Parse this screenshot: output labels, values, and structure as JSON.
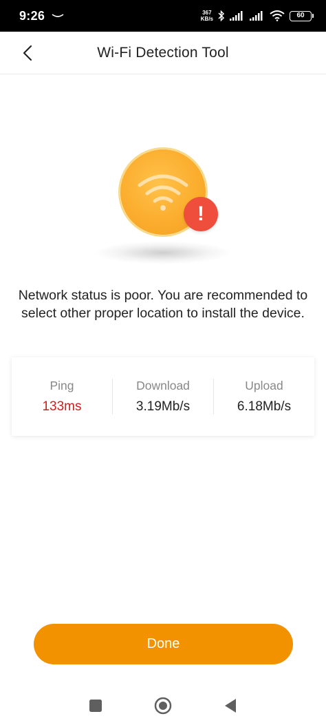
{
  "status_bar": {
    "time": "9:26",
    "net_speed_value": "367",
    "net_speed_unit": "KB/s",
    "battery": "60",
    "icons": [
      "notification-swipe-icon",
      "bluetooth-icon",
      "signal-icon",
      "signal-icon",
      "wifi-icon",
      "battery-icon"
    ]
  },
  "header": {
    "title": "Wi-Fi Detection Tool",
    "back_icon": "chevron-left-icon"
  },
  "illustration": {
    "main_icon": "wifi-icon",
    "badge_icon": "exclamation-icon",
    "badge_text": "!",
    "circle_color": "#fbad2e",
    "badge_color": "#ee4e3b"
  },
  "message": "Network status is poor. You are recommended to select other proper location to install the device.",
  "stats": [
    {
      "label": "Ping",
      "value": "133ms"
    },
    {
      "label": "Download",
      "value": "3.19Mb/s"
    },
    {
      "label": "Upload",
      "value": "6.18Mb/s"
    }
  ],
  "done_label": "Done",
  "colors": {
    "accent": "#f39200",
    "ping_value": "#c7211f",
    "text": "#222222",
    "muted": "#888888"
  },
  "nav": {
    "buttons": [
      "recents-square-icon",
      "home-circle-icon",
      "back-triangle-icon"
    ]
  }
}
